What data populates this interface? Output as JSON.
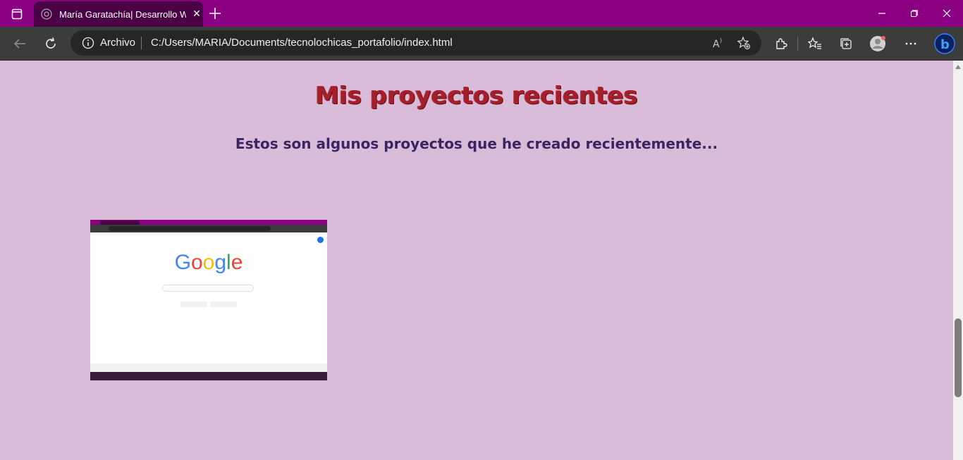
{
  "browser": {
    "tab": {
      "title": "María Garatachía| Desarrollo Web",
      "favicon": "globe-icon"
    },
    "address": {
      "label": "Archivo",
      "url": "C:/Users/MARIA/Documents/tecnolochicas_portafolio/index.html"
    },
    "colors": {
      "titlebar": "#8b0083",
      "toolbar": "#3c3c3c",
      "page_bg": "#d8bcd9"
    }
  },
  "page": {
    "heading": "Mis proyectos recientes",
    "subheading": "Estos son algunos proyectos que he creado recientemente...",
    "projects": [
      {
        "image": "google-homepage-screenshot",
        "thumb_logo": "Google"
      }
    ],
    "colors": {
      "heading": "#a31f2c",
      "subheading": "#3b2560"
    }
  }
}
